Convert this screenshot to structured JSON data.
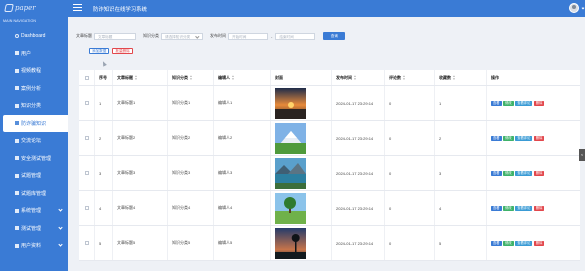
{
  "app": {
    "logo_text": "paper",
    "title": "防诈知识在线学习系统"
  },
  "sidebar": {
    "caption": "MAIN NAVIGATION",
    "items": [
      {
        "label": "Dashboard",
        "icon": "dashboard-icon",
        "active": false,
        "chevron": false
      },
      {
        "label": "用户",
        "icon": "user-icon",
        "active": false,
        "chevron": false
      },
      {
        "label": "视频教程",
        "icon": "video-icon",
        "active": false,
        "chevron": false
      },
      {
        "label": "案例分析",
        "icon": "case-icon",
        "active": false,
        "chevron": false
      },
      {
        "label": "知识分类",
        "icon": "category-icon",
        "active": false,
        "chevron": false
      },
      {
        "label": "防诈骗知识",
        "icon": "knowledge-icon",
        "active": true,
        "chevron": false
      },
      {
        "label": "交流论坛",
        "icon": "forum-icon",
        "active": false,
        "chevron": false
      },
      {
        "label": "安全测试管理",
        "icon": "test-icon",
        "active": false,
        "chevron": false
      },
      {
        "label": "试题管理",
        "icon": "question-icon",
        "active": false,
        "chevron": false
      },
      {
        "label": "试题库管理",
        "icon": "bank-icon",
        "active": false,
        "chevron": false
      },
      {
        "label": "系统管理",
        "icon": "system-icon",
        "active": false,
        "chevron": true
      },
      {
        "label": "测试管理",
        "icon": "exam-icon",
        "active": false,
        "chevron": true
      },
      {
        "label": "用户资料",
        "icon": "profile-icon",
        "active": false,
        "chevron": true
      }
    ]
  },
  "filters": {
    "title_label": "文章标题",
    "title_placeholder": "文章标题",
    "category_label": "知识分类",
    "category_placeholder": "请选择知识分类",
    "time_label": "发布时间",
    "start_placeholder": "开始时间",
    "dash": "-",
    "end_placeholder": "结束时间",
    "search_label": "查询"
  },
  "toolbar": {
    "add_label": "添加数据",
    "delete_label": "批量删除"
  },
  "table": {
    "headers": [
      "序号",
      "文章标题",
      "知识分类",
      "编辑人",
      "封面",
      "发布时间",
      "评论数",
      "收藏数",
      "操作"
    ],
    "sort_icon": "sort-icon",
    "rows": [
      {
        "index": "1",
        "title": "文章标题1",
        "category": "知识分类1",
        "editor": "编辑人1",
        "cover": "sunset-photo",
        "time": "2024-01-17 23:29:14",
        "comments": "0",
        "favorites": "1"
      },
      {
        "index": "2",
        "title": "文章标题2",
        "category": "知识分类2",
        "editor": "编辑人2",
        "cover": "mountain-photo",
        "time": "2024-01-17 23:29:14",
        "comments": "0",
        "favorites": "2"
      },
      {
        "index": "3",
        "title": "文章标题3",
        "category": "知识分类3",
        "editor": "编辑人3",
        "cover": "lake-photo",
        "time": "2024-01-17 23:29:14",
        "comments": "0",
        "favorites": "3"
      },
      {
        "index": "4",
        "title": "文章标题4",
        "category": "知识分类4",
        "editor": "编辑人4",
        "cover": "tree-photo",
        "time": "2024-01-17 23:29:14",
        "comments": "0",
        "favorites": "4"
      },
      {
        "index": "5",
        "title": "文章标题5",
        "category": "知识分类5",
        "editor": "编辑人5",
        "cover": "dusk-photo",
        "time": "2024-01-17 23:29:14",
        "comments": "0",
        "favorites": "5"
      }
    ],
    "ops": {
      "view": "查看",
      "edit": "修改",
      "comment": "查看评论",
      "delete": "删除"
    }
  },
  "colors": {
    "primary": "#3a7bd5",
    "success": "#3fb26a",
    "danger": "#e2474c",
    "background": "#eef1f6"
  },
  "side_tab": {
    "label": "<"
  }
}
